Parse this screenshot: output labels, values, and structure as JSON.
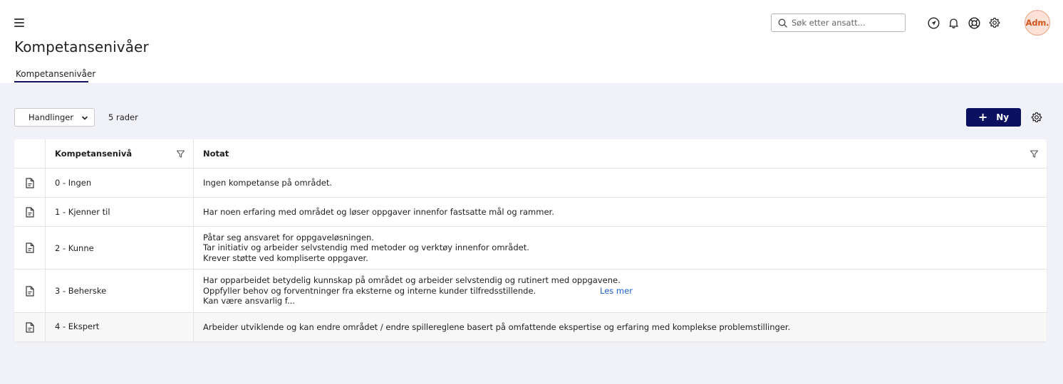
{
  "header": {
    "page_title": "Kompetansenivåer",
    "tab_label": "Kompetansenivåer",
    "search_placeholder": "Søk etter ansatt...",
    "avatar_text": "Adm."
  },
  "toolbar": {
    "actions_label": "Handlinger",
    "rows_count": "5 rader",
    "new_label": "Ny"
  },
  "table": {
    "columns": [
      "Kompetansenivå",
      "Notat"
    ],
    "rows": [
      {
        "level": "0 - Ingen",
        "note": [
          "Ingen kompetanse på området."
        ]
      },
      {
        "level": "1 - Kjenner til",
        "note": [
          "Har noen erfaring med området og løser oppgaver innenfor fastsatte mål og rammer."
        ]
      },
      {
        "level": "2 - Kunne",
        "note": [
          "Påtar seg ansvaret for oppgaveløsningen.",
          "Tar initiativ og arbeider selvstendig med metoder og verktøy innenfor området.",
          "Krever støtte ved kompliserte oppgaver."
        ]
      },
      {
        "level": "3 - Beherske",
        "note": [
          "Har opparbeidet betydelig kunnskap på området og arbeider selvstendig og rutinert med oppgavene.",
          "Oppfyller behov og forventninger fra eksterne og interne kunder tilfredsstillende.",
          "Kan være ansvarlig f..."
        ],
        "read_more": "Les mer"
      },
      {
        "level": "4 - Ekspert",
        "note": [
          "Arbeider utviklende og kan endre området / endre spillereglene basert på omfattende ekspertise og erfaring med komplekse problemstillinger."
        ]
      }
    ]
  },
  "icons": {
    "menu": "hamburger-menu-icon",
    "search": "search-icon",
    "navigate": "navigation-arrow-icon",
    "notifications": "bell-icon",
    "help": "lifebuoy-icon",
    "settings": "gear-icon",
    "filter": "filter-icon",
    "row": "document-icon",
    "add": "plus-icon"
  },
  "colors": {
    "primary": "#0b1061",
    "link": "#1b5fc4",
    "avatar_bg": "#fbe1d6",
    "avatar_text": "#d2541c",
    "content_bg": "#f1f2f7"
  }
}
